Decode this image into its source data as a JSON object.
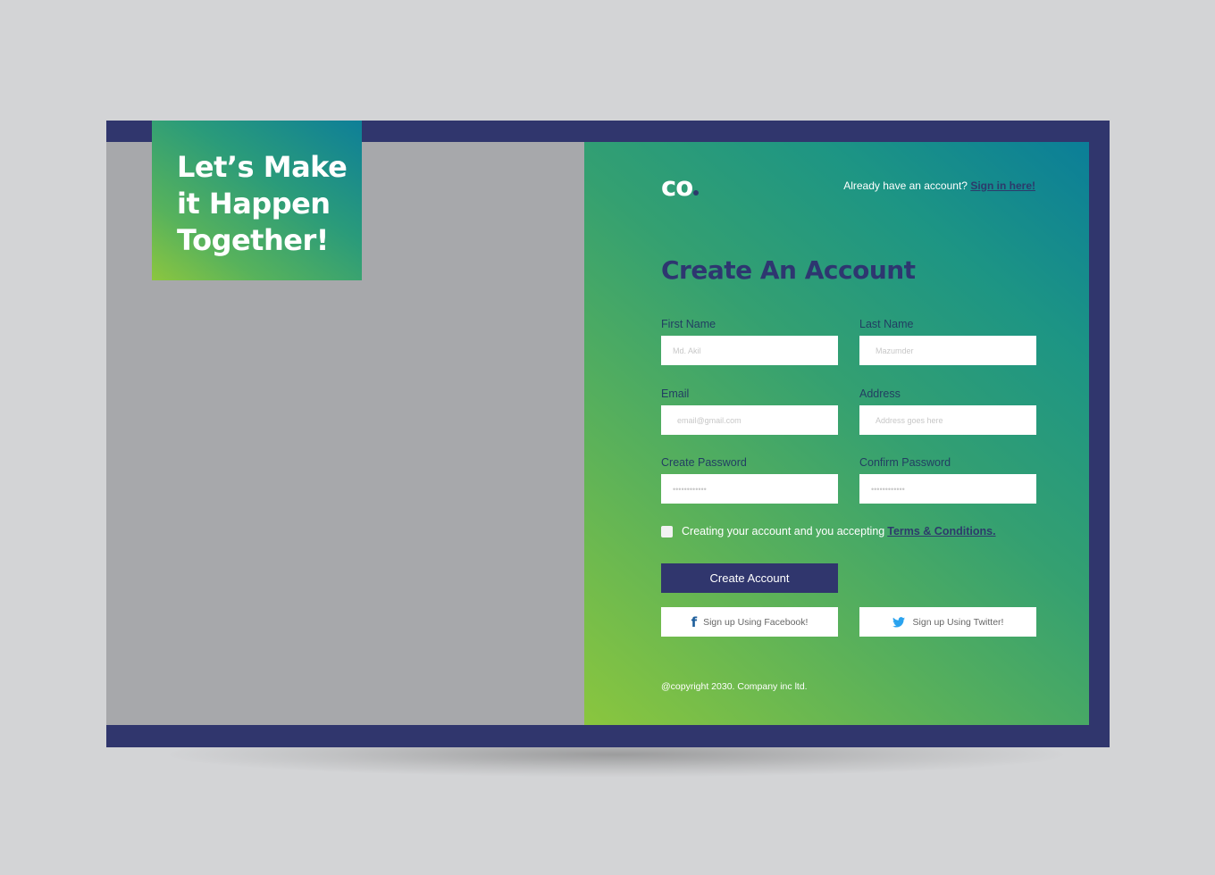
{
  "hero": {
    "title": "Let’s Make\nit Happen\nTogether!"
  },
  "header": {
    "logo": "CO",
    "signin_prompt": "Already have an account?",
    "signin_link": "Sign in here!"
  },
  "form": {
    "title": "Create An Account",
    "fields": [
      {
        "label": "First Name",
        "placeholder": "Md. Akil",
        "type": "text"
      },
      {
        "label": "Last Name",
        "placeholder": "Mazumder",
        "type": "text"
      },
      {
        "label": "Email",
        "placeholder": "email@gmail.com",
        "type": "email"
      },
      {
        "label": "Address",
        "placeholder": "Address goes here",
        "type": "text"
      },
      {
        "label": "Create Password",
        "placeholder": "••••••••••••",
        "type": "password"
      },
      {
        "label": "Confirm Password",
        "placeholder": "••••••••••••",
        "type": "password"
      }
    ],
    "terms_text": "Creating your account and you accepting",
    "terms_link": "Terms & Conditions.",
    "terms_checked": false,
    "submit_label": "Create Account",
    "facebook_label": "Sign up Using Facebook!",
    "twitter_label": "Sign up Using Twitter!",
    "facebook_icon": "facebook-icon",
    "twitter_icon": "twitter-icon"
  },
  "footer": {
    "copyright": "@copyright 2030. Company inc ltd."
  },
  "colors": {
    "frame": "#30366d",
    "accent_navy": "#2e3670",
    "gradient_teal": "#0b7e98",
    "gradient_lime": "#8ac63e",
    "placeholder_gray": "#a7a8ab",
    "background": "#d3d4d6"
  }
}
